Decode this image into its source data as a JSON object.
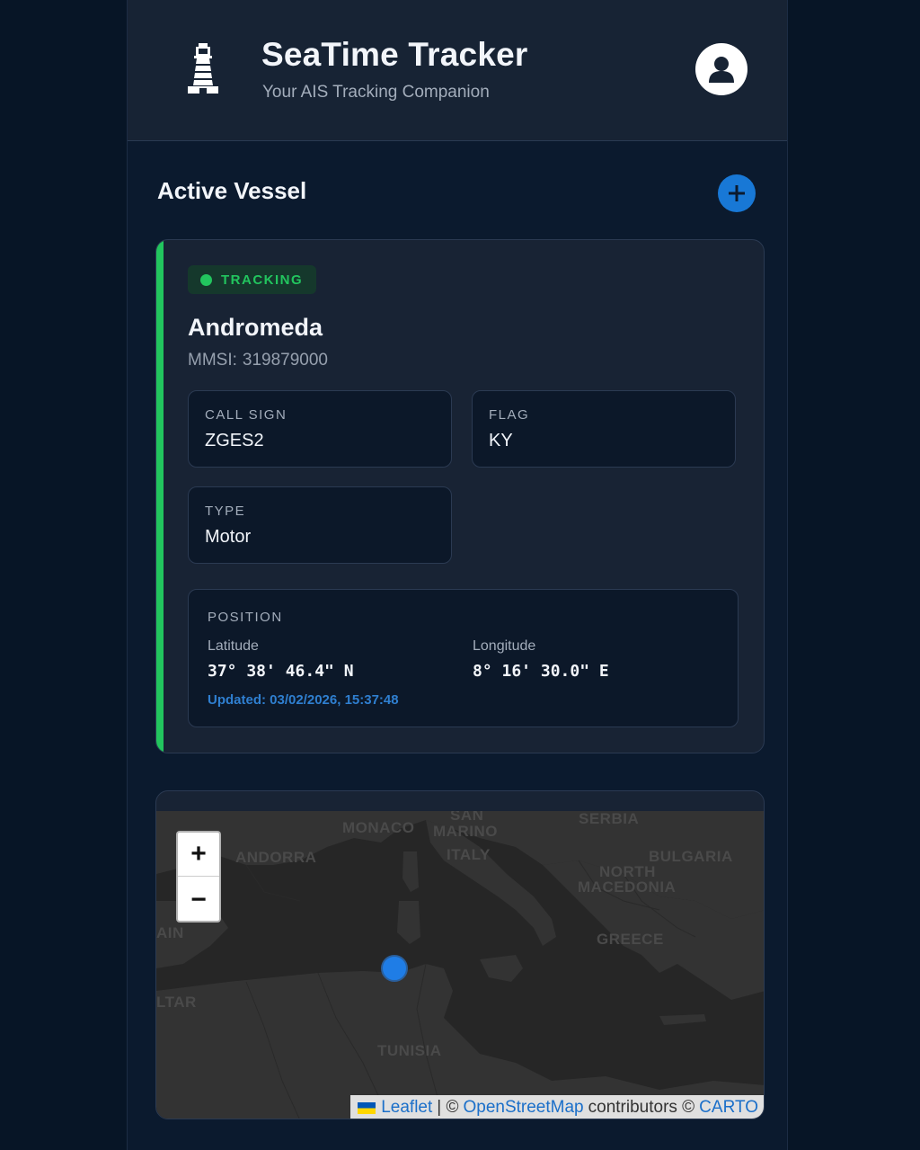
{
  "header": {
    "title": "SeaTime Tracker",
    "subtitle": "Your AIS Tracking Companion",
    "logo_icon": "lighthouse-icon",
    "avatar_icon": "user-icon"
  },
  "section": {
    "title": "Active Vessel",
    "add_icon": "plus-icon"
  },
  "vessel": {
    "status": "TRACKING",
    "status_color": "#22c55e",
    "name": "Andromeda",
    "mmsi_label": "MMSI:",
    "mmsi": "319879000",
    "fields": [
      {
        "label": "CALL SIGN",
        "value": "ZGES2"
      },
      {
        "label": "FLAG",
        "value": "KY"
      },
      {
        "label": "TYPE",
        "value": "Motor"
      }
    ],
    "position": {
      "title": "POSITION",
      "latitude_label": "Latitude",
      "latitude": "37° 38' 46.4\" N",
      "longitude_label": "Longitude",
      "longitude": "8° 16' 30.0\" E",
      "updated": "Updated: 03/02/2026, 15:37:48"
    }
  },
  "map": {
    "labels": [
      "MONACO",
      "SAN",
      "MARINO",
      "SERBIA",
      "ANDORRA",
      "ITALY",
      "BULGARIA",
      "NORTH",
      "MACEDONIA",
      "AIN",
      "GREECE",
      "LTAR",
      "TUNISIA"
    ],
    "zoom_in": "+",
    "zoom_out": "−",
    "attribution": {
      "leaflet": "Leaflet",
      "sep": "| ©",
      "osm": "OpenStreetMap",
      "contributors": "contributors ©",
      "carto": "CARTO"
    },
    "accent": "#1f7de6"
  }
}
